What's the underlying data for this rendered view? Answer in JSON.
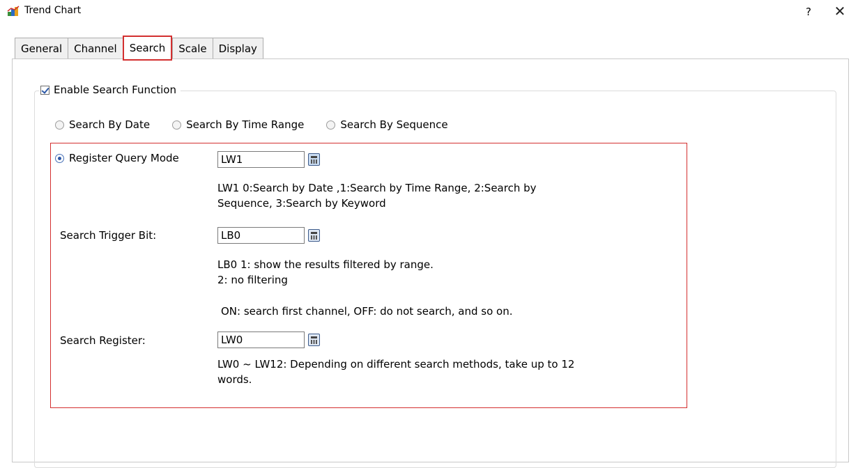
{
  "window": {
    "title": "Trend Chart",
    "help_label": "?",
    "close_label": "✕"
  },
  "tabs": [
    {
      "label": "General"
    },
    {
      "label": "Channel"
    },
    {
      "label": "Search",
      "active": true
    },
    {
      "label": "Scale"
    },
    {
      "label": "Display"
    }
  ],
  "search": {
    "enable_label": "Enable Search Function",
    "enable_checked": true,
    "radios": [
      {
        "label": "Search By Date"
      },
      {
        "label": "Search By Time Range"
      },
      {
        "label": "Search By Sequence"
      }
    ],
    "register_query": {
      "label": "Register Query Mode",
      "value": "LW1",
      "desc_line1": "LW1 0:Search by Date ,1:Search by Time Range, 2:Search by",
      "desc_line2": "Sequence, 3:Search by Keyword"
    },
    "trigger_bit": {
      "label": "Search Trigger Bit:",
      "value": "LB0",
      "desc_line1": "LB0 1: show the results filtered by range.",
      "desc_line2": "2: no filtering",
      "desc_line3": "ON: search first channel, OFF: do not search, and so on."
    },
    "search_register": {
      "label": "Search Register:",
      "value": "LW0",
      "desc_line1": "LW0 ~ LW12: Depending on different search methods, take up to 12",
      "desc_line2": "words."
    }
  },
  "colors": {
    "highlight_border": "#d32f2f",
    "checkbox_tick": "#2e5aa8"
  }
}
